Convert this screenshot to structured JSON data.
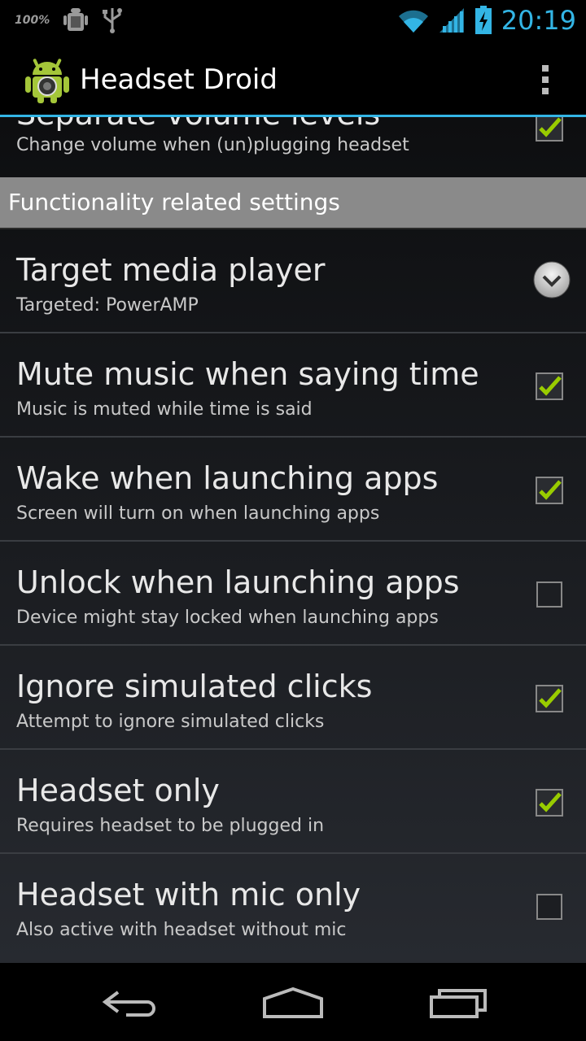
{
  "status_bar": {
    "battery_percent": "100%",
    "time": "20:19",
    "icons": [
      "android-debug-icon",
      "usb-icon",
      "wifi-icon",
      "signal-icon",
      "battery-charging-icon"
    ]
  },
  "action_bar": {
    "title": "Headset Droid",
    "icon": "headset-droid-app-icon",
    "overflow_icon": "overflow-menu-icon"
  },
  "partial_item": {
    "title": "Separate volume levels",
    "summary": "Change volume when (un)plugging headset",
    "checked": true
  },
  "category": {
    "label": "Functionality related settings"
  },
  "items": [
    {
      "title": "Target media player",
      "summary": "Targeted: PowerAMP",
      "widget": "dropdown"
    },
    {
      "title": "Mute music when saying time",
      "summary": "Music is muted while time is said",
      "widget": "checkbox",
      "checked": true
    },
    {
      "title": "Wake when launching apps",
      "summary": "Screen will turn on when launching apps",
      "widget": "checkbox",
      "checked": true
    },
    {
      "title": "Unlock when launching apps",
      "summary": "Device might stay locked when launching apps",
      "widget": "checkbox",
      "checked": false
    },
    {
      "title": "Ignore simulated clicks",
      "summary": "Attempt to ignore simulated clicks",
      "widget": "checkbox",
      "checked": true
    },
    {
      "title": "Headset only",
      "summary": "Requires headset to be plugged in",
      "widget": "checkbox",
      "checked": true
    },
    {
      "title": "Headset with mic only",
      "summary": "Also active with headset without mic",
      "widget": "checkbox",
      "checked": false
    }
  ],
  "nav_bar": {
    "icons": [
      "back-icon",
      "home-icon",
      "recent-apps-icon"
    ]
  },
  "colors": {
    "accent": "#33b5e5",
    "check_green": "#99cc00",
    "category_bg": "#8a8a8a"
  }
}
